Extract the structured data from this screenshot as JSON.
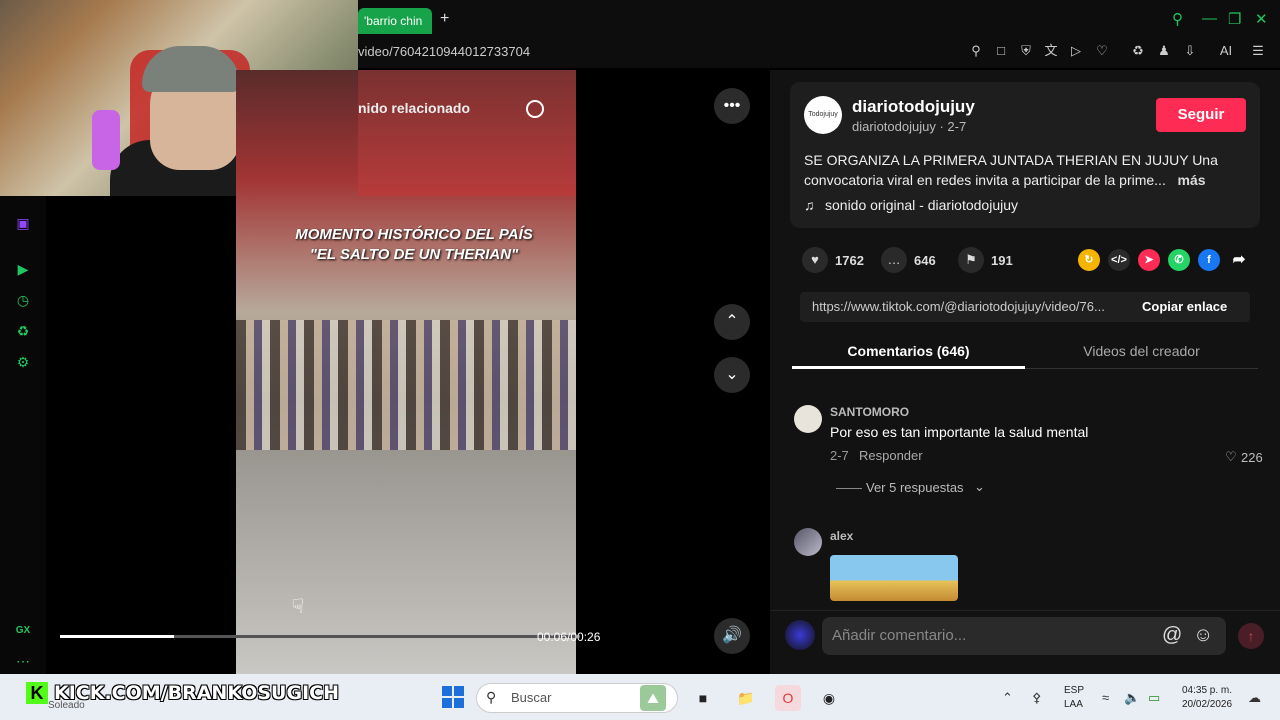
{
  "browser": {
    "tab_title": "'barrio chin",
    "new_tab": "+",
    "url": "video/7604210944012733704",
    "ai_label": "AI"
  },
  "video": {
    "related_label": "nido relacionado",
    "caption_line1": "MOMENTO HISTÓRICO DEL PAÍS",
    "caption_line2": "\"EL SALTO DE UN THERIAN\"",
    "timecode": "00:06/00:26",
    "progress": 0.22
  },
  "post": {
    "avatar_text": "Todojujuy",
    "author_name": "diariotodojujuy",
    "author_sub": "diariotodojujuy · 2-7",
    "follow_label": "Seguir",
    "description": "SE ORGANIZA LA PRIMERA JUNTADA THERIAN EN JUJUY Una convocatoria viral en redes invita a participar de la prime...",
    "more_label": "más",
    "music": "sonido original - diariotodojujuy",
    "likes": "1762",
    "comments": "646",
    "saves": "191",
    "link": "https://www.tiktok.com/@diariotodojujuy/video/76...",
    "copy_label": "Copiar enlace"
  },
  "tabs": {
    "comments": "Comentarios (646)",
    "creator": "Videos del creador"
  },
  "comments": [
    {
      "user": "SANTOMORO",
      "text": "Por eso es tan importante la salud mental",
      "date": "2-7",
      "reply": "Responder",
      "likes": "226",
      "replies": "Ver 5 respuestas"
    },
    {
      "user": "alex"
    }
  ],
  "comment_input": {
    "placeholder": "Añadir comentario..."
  },
  "overlay": {
    "kick_text": "KICK.COM/BRANKOSUGICH",
    "weather": "Soleado"
  },
  "taskbar": {
    "search_placeholder": "Buscar",
    "lang1": "ESP",
    "lang2": "LAA",
    "time": "04:35 p. m.",
    "date": "20/02/2026"
  },
  "sidebar": {
    "gx_label": "GX"
  },
  "colors": {
    "accent": "#22c55e",
    "follow": "#fe2c55"
  }
}
